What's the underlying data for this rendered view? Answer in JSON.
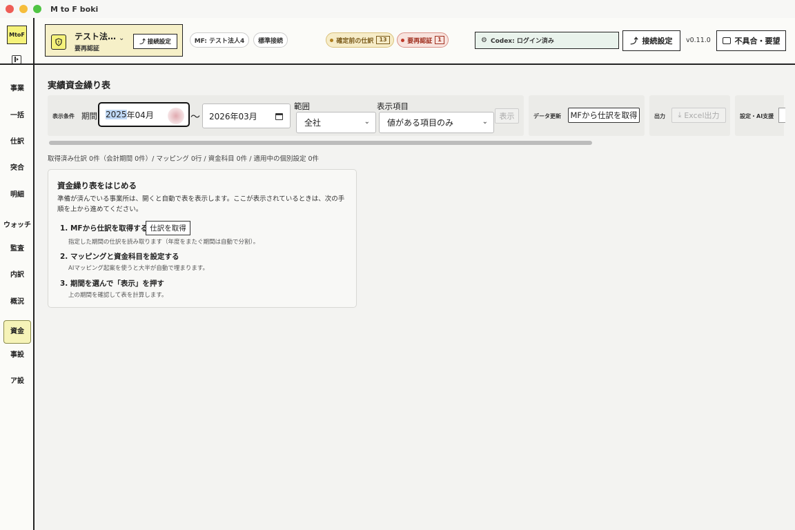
{
  "window": {
    "title": "M to F boki"
  },
  "sidebar": {
    "logo": "MtoF",
    "items": [
      {
        "label": "事業",
        "active": false
      },
      {
        "label": "一括",
        "active": false
      },
      {
        "label": "仕訳",
        "active": false
      },
      {
        "label": "突合",
        "active": false
      },
      {
        "label": "明細",
        "active": false
      },
      {
        "label": "ウォッチ",
        "active": false
      },
      {
        "label": "監査",
        "active": false
      },
      {
        "label": "内訳",
        "active": false
      },
      {
        "label": "概況",
        "active": false
      },
      {
        "label": "資金",
        "active": true
      },
      {
        "label": "事設",
        "active": false
      },
      {
        "label": "ア設",
        "active": false
      }
    ]
  },
  "header": {
    "company": {
      "name": "テスト法…",
      "status": "要再認証",
      "conn_button": "接続設定"
    },
    "mf_pill": "MF: テスト法人4",
    "std_pill": "標準接続",
    "pending": {
      "label": "確定前の仕訳",
      "count": "13",
      "color": "#b08020"
    },
    "reauth": {
      "label": "要再認証",
      "count": "1",
      "color": "#c03a2a"
    },
    "codex": "Codex: ログイン済み",
    "conn_button": "接続設定",
    "version": "v0.11.0",
    "feedback_button": "不具合・要望"
  },
  "main": {
    "title": "実績資金繰り表",
    "toolbar": {
      "conditions_label": "表示条件",
      "period_label": "期間",
      "start_year": "2025",
      "start_rest": "年04月",
      "tilde": "〜",
      "end_date": "2026年03月",
      "scope_label": "範囲",
      "scope_value": "全社",
      "items_label": "表示項目",
      "items_value": "値がある項目のみ",
      "show_button": "表示",
      "update_label": "データ更新",
      "fetch_button": "MFから仕訳を取得",
      "output_label": "出力",
      "excel_button": "Excel出力",
      "settings_label": "設定・AI支援"
    },
    "stats": "取得済み仕訳 0件（会計期間 0件）/ マッピング 0行 / 資金科目 0件 / 適用中の個別設定 0件",
    "card": {
      "title": "資金繰り表をはじめる",
      "desc": "準備が済んでいる事業所は、開くと自動で表を表示します。ここが表示されているときは、次の手順を上から進めてください。",
      "steps": [
        {
          "title": "1. MFから仕訳を取得する",
          "sub": "指定した期間の仕訳を読み取ります（年度をまたぐ期間は自動で分割）。",
          "button": "仕訳を取得"
        },
        {
          "title": "2. マッピングと資金科目を設定する",
          "sub": "AIマッピング起案を使うと大半が自動で埋まります。"
        },
        {
          "title": "3. 期間を選んで「表示」を押す",
          "sub": "上の期間を確認して表を計算します。"
        }
      ]
    }
  }
}
